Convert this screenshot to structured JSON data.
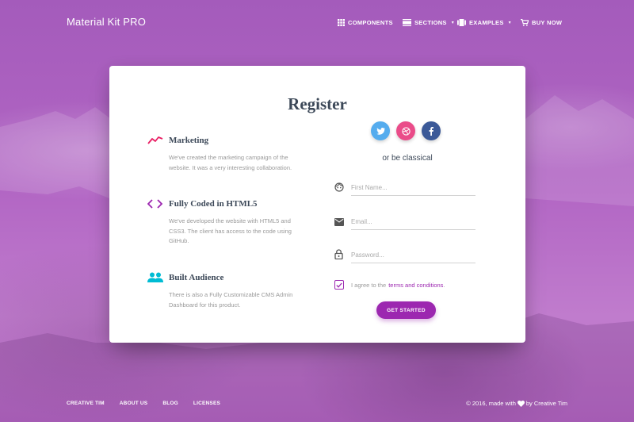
{
  "navbar": {
    "brand": "Material Kit PRO",
    "items": [
      {
        "label": "COMPONENTS",
        "icon": "grid-icon"
      },
      {
        "label": "SECTIONS",
        "icon": "view-day-icon",
        "dropdown": true
      },
      {
        "label": "EXAMPLES",
        "icon": "layers-icon",
        "dropdown": true
      },
      {
        "label": "BUY NOW",
        "icon": "shopping-cart-icon"
      }
    ]
  },
  "card": {
    "title": "Register",
    "info": [
      {
        "title": "Marketing",
        "icon": "timeline-icon",
        "color": "#e91e63",
        "description": "We've created the marketing campaign of the website. It was a very interesting collaboration."
      },
      {
        "title": "Fully Coded in HTML5",
        "icon": "code-icon",
        "color": "#9c27b0",
        "description": "We've developed the website with HTML5 and CSS3. The client has access to the code using GitHub."
      },
      {
        "title": "Built Audience",
        "icon": "group-icon",
        "color": "#00bcd4",
        "description": "There is also a Fully Customizable CMS Admin Dashboard for this product."
      }
    ],
    "socials": [
      {
        "name": "twitter",
        "color": "#55acee"
      },
      {
        "name": "dribbble",
        "color": "#ea4c89"
      },
      {
        "name": "facebook",
        "color": "#3b5998"
      }
    ],
    "alt_text": "or be classical",
    "fields": [
      {
        "placeholder": "First Name...",
        "icon": "face-icon"
      },
      {
        "placeholder": "Email...",
        "icon": "email-icon"
      },
      {
        "placeholder": "Password...",
        "icon": "lock-icon"
      }
    ],
    "agree_text": "I agree to the",
    "agree_link": "terms and conditions",
    "agree_end": ".",
    "agree_checked": true,
    "button": "GET STARTED",
    "accent": "#9c27b0"
  },
  "footer": {
    "links": [
      "CREATIVE TIM",
      "ABOUT US",
      "BLOG",
      "LICENSES"
    ],
    "copyright_prefix": "© 2016, made with",
    "copyright_suffix": "by Creative Tim"
  }
}
